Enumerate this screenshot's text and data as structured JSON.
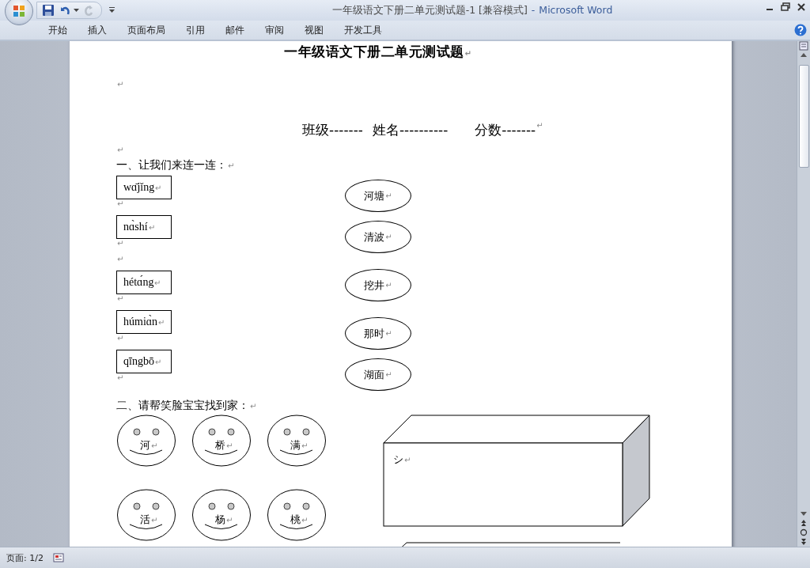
{
  "window": {
    "title": "一年级语文下册二单元测试题-1 [兼容模式]",
    "separator": "-",
    "app": "Microsoft Word"
  },
  "ribbon_tabs": [
    {
      "label": "开始"
    },
    {
      "label": "插入"
    },
    {
      "label": "页面布局"
    },
    {
      "label": "引用"
    },
    {
      "label": "邮件"
    },
    {
      "label": "审阅"
    },
    {
      "label": "视图"
    },
    {
      "label": "开发工具"
    }
  ],
  "document": {
    "title": {
      "text": "一年级语文下册二单元测试题",
      "mark": "↵"
    },
    "blank_line": {
      "mark": "↵"
    },
    "info_line": {
      "parts": [
        "班级-------",
        "姓名----------",
        "分数-------"
      ],
      "mark": "↵"
    },
    "blank_line_2": {
      "mark": "↵"
    },
    "section_1": {
      "heading": "一、让我们来连一连：",
      "mark": "↵",
      "pinyin": [
        {
          "text": "wɑ̄jǐng",
          "mark": "↵",
          "after_marks": [
            "↵"
          ]
        },
        {
          "text": "nɑ̀shí",
          "mark": "↵",
          "after_marks": [
            "↵",
            "↵"
          ]
        },
        {
          "text": "hétɑ́ng",
          "mark": "↵",
          "after_marks": [
            "↵"
          ]
        },
        {
          "text": "húmiɑ̀n",
          "mark": "↵",
          "after_marks": [
            "↵"
          ]
        },
        {
          "text": "qīngbō",
          "mark": "↵",
          "after_marks": [
            "↵"
          ]
        }
      ],
      "words": [
        {
          "text": "河塘",
          "mark": "↵"
        },
        {
          "text": "清波",
          "mark": "↵"
        },
        {
          "text": "挖井",
          "mark": "↵"
        },
        {
          "text": "那时",
          "mark": "↵"
        },
        {
          "text": "湖面",
          "mark": "↵"
        }
      ]
    },
    "section_2": {
      "heading": "二、请帮笑脸宝宝找到家：",
      "mark": "↵",
      "faces": [
        {
          "char": "河",
          "mark": "↵"
        },
        {
          "char": "桥",
          "mark": "↵"
        },
        {
          "char": "满",
          "mark": "↵"
        },
        {
          "char": "活",
          "mark": "↵"
        },
        {
          "char": "杨",
          "mark": "↵"
        },
        {
          "char": "桃",
          "mark": "↵"
        }
      ],
      "house": {
        "text": "シ",
        "mark": "↵"
      }
    }
  },
  "status_bar": {
    "page": "页面: 1/2"
  }
}
